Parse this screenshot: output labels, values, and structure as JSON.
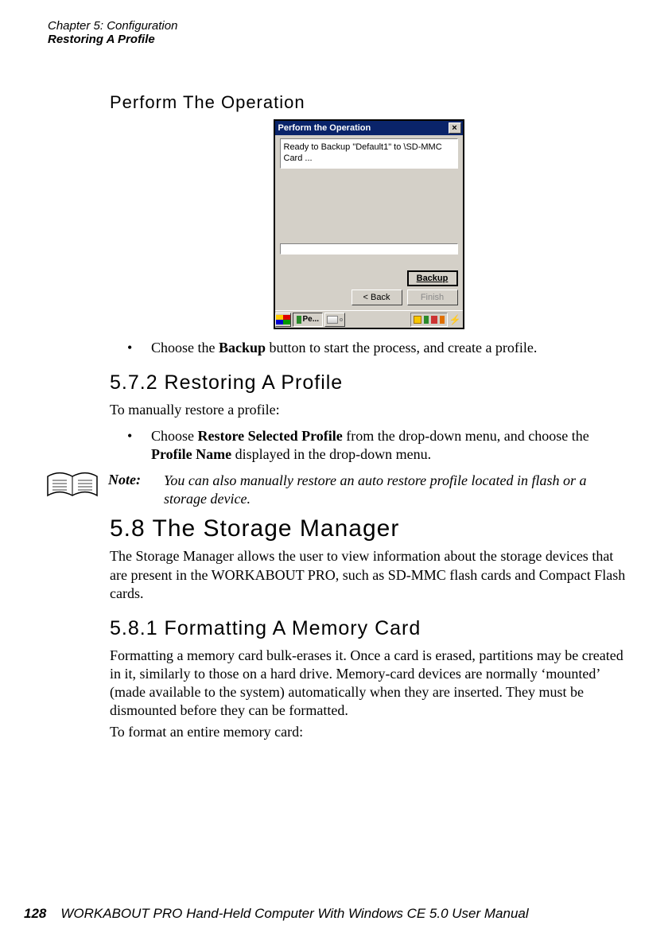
{
  "chapter": "Chapter 5: Configuration",
  "header_sub": "Restoring A Profile",
  "h_perform": "Perform The Operation",
  "dialog": {
    "title": "Perform the Operation",
    "close": "×",
    "message": "Ready to Backup \"Default1\" to \\SD-MMC Card ...",
    "btn_backup": "Backup",
    "btn_back": "< Back",
    "btn_finish": "Finish",
    "task_label": "Pe..."
  },
  "bullet_choose_backup_pre": "Choose the ",
  "bullet_choose_backup_bold": "Backup",
  "bullet_choose_backup_post": " button to start the process, and create a profile.",
  "h_572": "5.7.2  Restoring A Profile",
  "p_restore_intro": "To manually restore a profile:",
  "bullet_restore_pre": "Choose ",
  "bullet_restore_b1": "Restore Selected Profile",
  "bullet_restore_mid": " from the drop-down menu, and choose the ",
  "bullet_restore_b2": "Profile Name",
  "bullet_restore_post": " displayed in the drop-down menu.",
  "note_label": "Note:",
  "note_body": "You can also manually restore an auto restore profile located in flash or a storage device.",
  "h_58": "5.8  The Storage Manager",
  "p_58": "The Storage Manager allows the user to view information about the storage devices that are present in the WORKABOUT PRO, such as SD-MMC flash cards and Compact Flash cards.",
  "h_581": "5.8.1  Formatting A Memory Card",
  "p_581_1": "Formatting a memory card bulk-erases it. Once a card is erased, partitions may be created in it, similarly to those on a hard drive. Memory-card devices are normally ‘mounted’ (made available to the system) automatically when they are inserted. They must be dismounted before they can be formatted.",
  "p_581_2": "To format an entire memory card:",
  "page_number": "128",
  "footer_title": "WORKABOUT PRO Hand-Held Computer With Windows CE 5.0 User Manual"
}
